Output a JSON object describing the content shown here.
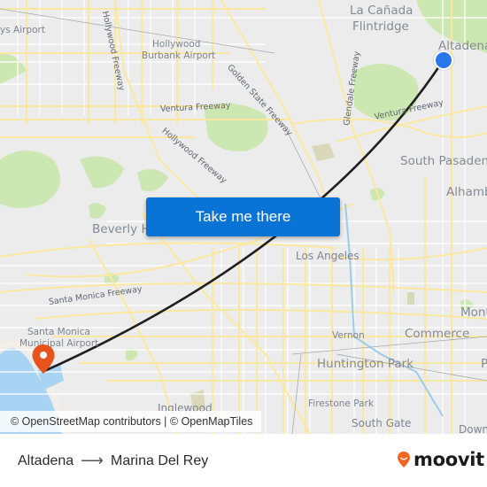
{
  "map": {
    "places": [
      {
        "name": "La Cañada",
        "cls": "big"
      },
      {
        "name": "Flintridge",
        "cls": "big"
      },
      {
        "name": "Altadena",
        "cls": "big"
      },
      {
        "name": "Hollywood",
        "cls": "small"
      },
      {
        "name": "Burbank Airport",
        "cls": "small"
      },
      {
        "name": "ys Airport",
        "cls": "small"
      },
      {
        "name": "South Pasadena",
        "cls": "big"
      },
      {
        "name": "Alhambra",
        "cls": "big"
      },
      {
        "name": "Beverly Hills",
        "cls": "big"
      },
      {
        "name": "Los Angeles",
        "cls": "mid"
      },
      {
        "name": "Santa Monica",
        "cls": "small"
      },
      {
        "name": "Municipal Airport",
        "cls": "small"
      },
      {
        "name": "Vernon",
        "cls": "small"
      },
      {
        "name": "Commerce",
        "cls": "big"
      },
      {
        "name": "Monterey Park",
        "cls": "big"
      },
      {
        "name": "Huntington Park",
        "cls": "big"
      },
      {
        "name": "Firestone Park",
        "cls": "small"
      },
      {
        "name": "South Gate",
        "cls": "mid"
      },
      {
        "name": "Inglewood",
        "cls": "mid"
      },
      {
        "name": "Downey",
        "cls": "mid"
      },
      {
        "name": "Pico Rivera",
        "cls": "big"
      }
    ],
    "roads": [
      "Hollywood Freeway",
      "Golden State Freeway",
      "Ventura Freeway",
      "Hollywood Freeway",
      "Glendale Freeway",
      "Ventura Freeway",
      "Santa Monica Freeway"
    ],
    "origin_marker": "Altadena",
    "destination_marker": "Marina Del Rey"
  },
  "cta": {
    "label": "Take me there"
  },
  "attribution": "© OpenStreetMap contributors | © OpenMapTiles",
  "route": {
    "from": "Altadena",
    "arrow": "⟶",
    "to": "Marina Del Rey"
  },
  "brand": {
    "name": "moovit",
    "color": "#f26522"
  },
  "colors": {
    "route_line": "#1f1f1f",
    "origin": "#2a77ea",
    "destination": "#e8531c",
    "button": "#0a74d6"
  }
}
